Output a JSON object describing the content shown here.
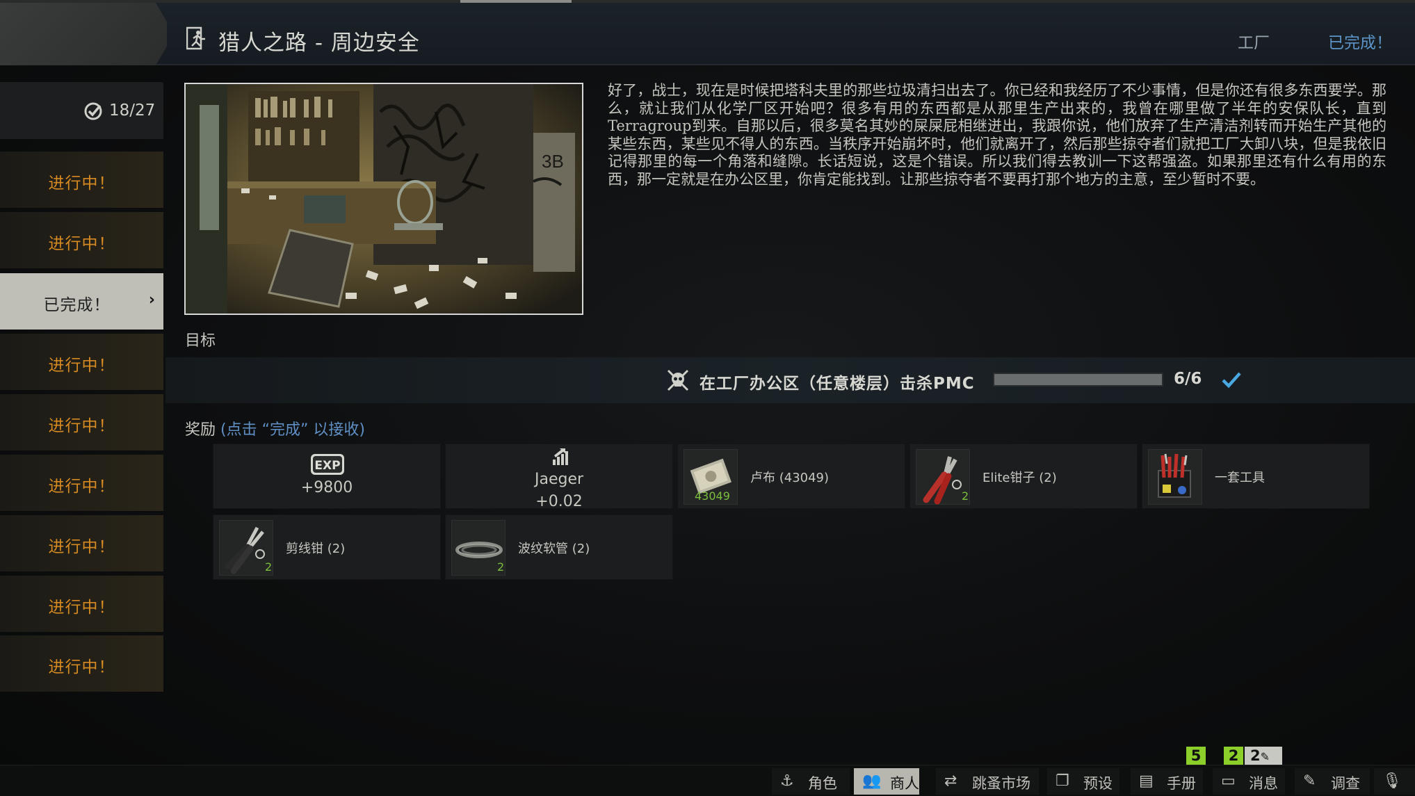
{
  "header": {
    "title": "猎人之路 - 周边安全",
    "location": "工厂",
    "status": "已完成！"
  },
  "quest_counter": "18/27",
  "sidebar": {
    "items": [
      {
        "label": "进行中！"
      },
      {
        "label": "进行中！"
      },
      {
        "label": "已完成！"
      },
      {
        "label": "进行中！"
      },
      {
        "label": "进行中！"
      },
      {
        "label": "进行中！"
      },
      {
        "label": "进行中！"
      },
      {
        "label": "进行中！"
      },
      {
        "label": "进行中！"
      }
    ]
  },
  "description": "好了，战士，现在是时候把塔科夫里的那些垃圾清扫出去了。你已经和我经历了不少事情，但是你还有很多东西要学。那么，就让我们从化学厂区开始吧？很多有用的东西都是从那里生产出来的，我曾在哪里做了半年的安保队长，直到Terragroup到来。自那以后，很多莫名其妙的屎屎屁相继迸出，我跟你说，他们放弃了生产清洁剂转而开始生产其他的某些东西，某些见不得人的东西。当秩序开始崩坏时，他们就离开了，然后那些掠夺者们就把工厂大卸八块，但是我依旧记得那里的每一个角落和缝隙。长话短说，这是个错误。所以我们得去教训一下这帮强盗。如果那里还有什么有用的东西，那一定就是在办公区里，你肯定能找到。让那些掠夺者不要再打那个地方的主意，至少暂时不要。",
  "objectives": {
    "label": "目标",
    "items": [
      {
        "text": "在工厂办公区（任意楼层）击杀PMC",
        "count": "6/6",
        "progress": 1.0
      }
    ]
  },
  "rewards": {
    "label": "奖励",
    "hint": "(点击 “完成” 以接收)",
    "exp": {
      "badge": "EXP",
      "value": "+9800"
    },
    "rep": {
      "trader": "Jaeger",
      "value": "+0.02"
    },
    "items": [
      {
        "name": "卢布 (43049)",
        "count": "43049",
        "icon": "roubles-icon"
      },
      {
        "name": "Elite钳子 (2)",
        "count": "2",
        "icon": "pliers-icon"
      },
      {
        "name": "一套工具",
        "count": "",
        "icon": "toolset-icon"
      },
      {
        "name": "剪线钳 (2)",
        "count": "2",
        "icon": "wire-cutter-icon"
      },
      {
        "name": "波纹软管 (2)",
        "count": "2",
        "icon": "hose-icon"
      }
    ]
  },
  "bottom_nav": {
    "tabs": [
      {
        "label": "角色",
        "icon": "character-icon"
      },
      {
        "label": "商人",
        "icon": "traders-icon"
      },
      {
        "label": "跳蚤市场",
        "icon": "flea-market-icon"
      },
      {
        "label": "预设",
        "icon": "presets-icon"
      },
      {
        "label": "手册",
        "icon": "handbook-icon"
      },
      {
        "label": "消息",
        "icon": "messages-icon"
      },
      {
        "label": "调查",
        "icon": "survey-icon"
      }
    ],
    "badges": [
      "5",
      "2",
      "2"
    ]
  },
  "colors": {
    "in_progress": "#d68a22",
    "completed_accent": "#5c94c8",
    "count_green": "#7bbd3c",
    "badge_green": "#8ccf2a"
  }
}
